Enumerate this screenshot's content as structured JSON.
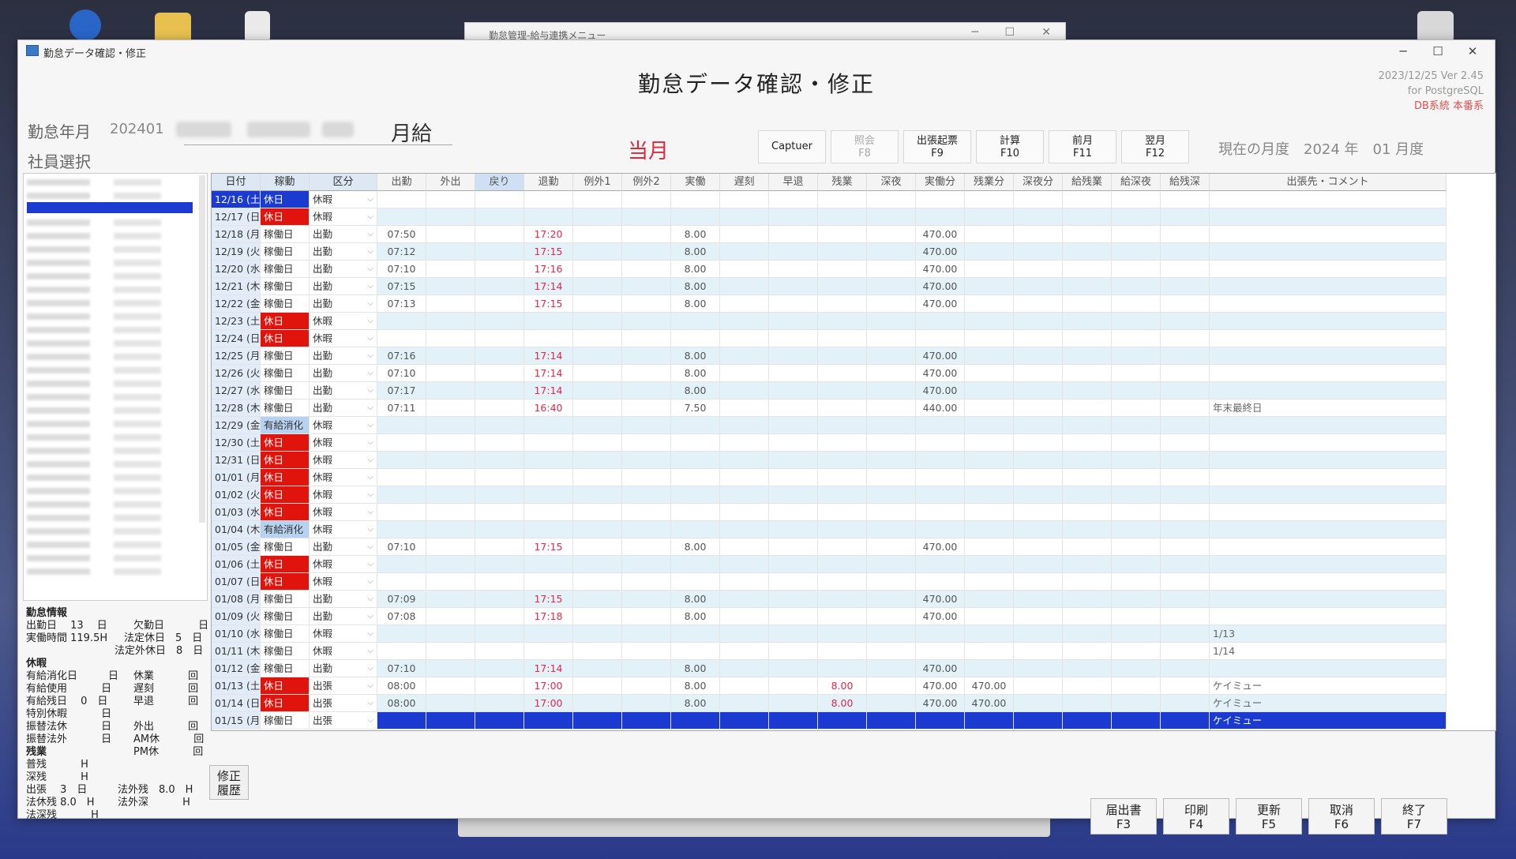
{
  "background_window": {
    "title": "勤怠管理-給与連携メニュー"
  },
  "window": {
    "title": "勤怠データ確認・修正"
  },
  "header": {
    "title": "勤怠データ確認・修正",
    "version": [
      "2023/12/25 Ver 2.45",
      "for PostgreSQL",
      "DB系統 本番系"
    ]
  },
  "filters": {
    "ym_label": "勤怠年月",
    "ym_value": "202401",
    "pay_type": "月給",
    "employee_label": "社員選択",
    "current_month_badge": "当月",
    "current_period": "現在の月度　2024 年　01 月度"
  },
  "toolbar": [
    {
      "label": "Captuer",
      "key": "",
      "disabled": false
    },
    {
      "label": "照会",
      "key": "F8",
      "disabled": true
    },
    {
      "label": "出張起票",
      "key": "F9",
      "disabled": false
    },
    {
      "label": "計算",
      "key": "F10",
      "disabled": false
    },
    {
      "label": "前月",
      "key": "F11",
      "disabled": false
    },
    {
      "label": "翌月",
      "key": "F12",
      "disabled": false
    }
  ],
  "columns": [
    "日付",
    "稼動",
    "区分",
    "出勤",
    "外出",
    "戻り",
    "退勤",
    "例外1",
    "例外2",
    "実働",
    "遅刻",
    "早退",
    "残業",
    "深夜",
    "実働分",
    "残業分",
    "深夜分",
    "給残業",
    "給深夜",
    "給残深",
    "出張先・コメント"
  ],
  "rows": [
    {
      "date": "12/16 (土)",
      "kado": "休日",
      "kubun": "休暇",
      "in": "",
      "out": "",
      "work": "",
      "zan": "",
      "wmin": "",
      "zmin": "",
      "comment": "",
      "type": "sel"
    },
    {
      "date": "12/17 (日)",
      "kado": "休日",
      "kubun": "休暇",
      "in": "",
      "out": "",
      "work": "",
      "zan": "",
      "wmin": "",
      "zmin": "",
      "comment": "",
      "type": "holiday"
    },
    {
      "date": "12/18 (月)",
      "kado": "稼働日",
      "kubun": "出勤",
      "in": "07:50",
      "out": "17:20",
      "work": "8.00",
      "zan": "",
      "wmin": "470.00",
      "zmin": "",
      "comment": "",
      "type": ""
    },
    {
      "date": "12/19 (火)",
      "kado": "稼働日",
      "kubun": "出勤",
      "in": "07:12",
      "out": "17:15",
      "work": "8.00",
      "zan": "",
      "wmin": "470.00",
      "zmin": "",
      "comment": "",
      "type": ""
    },
    {
      "date": "12/20 (水)",
      "kado": "稼働日",
      "kubun": "出勤",
      "in": "07:10",
      "out": "17:16",
      "work": "8.00",
      "zan": "",
      "wmin": "470.00",
      "zmin": "",
      "comment": "",
      "type": ""
    },
    {
      "date": "12/21 (木)",
      "kado": "稼働日",
      "kubun": "出勤",
      "in": "07:15",
      "out": "17:14",
      "work": "8.00",
      "zan": "",
      "wmin": "470.00",
      "zmin": "",
      "comment": "",
      "type": ""
    },
    {
      "date": "12/22 (金)",
      "kado": "稼働日",
      "kubun": "出勤",
      "in": "07:13",
      "out": "17:15",
      "work": "8.00",
      "zan": "",
      "wmin": "470.00",
      "zmin": "",
      "comment": "",
      "type": ""
    },
    {
      "date": "12/23 (土)",
      "kado": "休日",
      "kubun": "休暇",
      "in": "",
      "out": "",
      "work": "",
      "zan": "",
      "wmin": "",
      "zmin": "",
      "comment": "",
      "type": "holiday"
    },
    {
      "date": "12/24 (日)",
      "kado": "休日",
      "kubun": "休暇",
      "in": "",
      "out": "",
      "work": "",
      "zan": "",
      "wmin": "",
      "zmin": "",
      "comment": "",
      "type": "holiday"
    },
    {
      "date": "12/25 (月)",
      "kado": "稼働日",
      "kubun": "出勤",
      "in": "07:16",
      "out": "17:14",
      "work": "8.00",
      "zan": "",
      "wmin": "470.00",
      "zmin": "",
      "comment": "",
      "type": ""
    },
    {
      "date": "12/26 (火)",
      "kado": "稼働日",
      "kubun": "出勤",
      "in": "07:10",
      "out": "17:14",
      "work": "8.00",
      "zan": "",
      "wmin": "470.00",
      "zmin": "",
      "comment": "",
      "type": ""
    },
    {
      "date": "12/27 (水)",
      "kado": "稼働日",
      "kubun": "出勤",
      "in": "07:17",
      "out": "17:14",
      "work": "8.00",
      "zan": "",
      "wmin": "470.00",
      "zmin": "",
      "comment": "",
      "type": ""
    },
    {
      "date": "12/28 (木)",
      "kado": "稼働日",
      "kubun": "出勤",
      "in": "07:11",
      "out": "16:40",
      "work": "7.50",
      "zan": "",
      "wmin": "440.00",
      "zmin": "",
      "comment": "年末最終日",
      "type": ""
    },
    {
      "date": "12/29 (金)",
      "kado": "有給消化",
      "kubun": "休暇",
      "in": "",
      "out": "",
      "work": "",
      "zan": "",
      "wmin": "",
      "zmin": "",
      "comment": "",
      "type": "paid"
    },
    {
      "date": "12/30 (土)",
      "kado": "休日",
      "kubun": "休暇",
      "in": "",
      "out": "",
      "work": "",
      "zan": "",
      "wmin": "",
      "zmin": "",
      "comment": "",
      "type": "holiday"
    },
    {
      "date": "12/31 (日)",
      "kado": "休日",
      "kubun": "休暇",
      "in": "",
      "out": "",
      "work": "",
      "zan": "",
      "wmin": "",
      "zmin": "",
      "comment": "",
      "type": "holiday"
    },
    {
      "date": "01/01 (月)",
      "kado": "休日",
      "kubun": "休暇",
      "in": "",
      "out": "",
      "work": "",
      "zan": "",
      "wmin": "",
      "zmin": "",
      "comment": "",
      "type": "holiday"
    },
    {
      "date": "01/02 (火)",
      "kado": "休日",
      "kubun": "休暇",
      "in": "",
      "out": "",
      "work": "",
      "zan": "",
      "wmin": "",
      "zmin": "",
      "comment": "",
      "type": "holiday"
    },
    {
      "date": "01/03 (水)",
      "kado": "休日",
      "kubun": "休暇",
      "in": "",
      "out": "",
      "work": "",
      "zan": "",
      "wmin": "",
      "zmin": "",
      "comment": "",
      "type": "holiday"
    },
    {
      "date": "01/04 (木)",
      "kado": "有給消化",
      "kubun": "休暇",
      "in": "",
      "out": "",
      "work": "",
      "zan": "",
      "wmin": "",
      "zmin": "",
      "comment": "",
      "type": "paid"
    },
    {
      "date": "01/05 (金)",
      "kado": "稼働日",
      "kubun": "出勤",
      "in": "07:10",
      "out": "17:15",
      "work": "8.00",
      "zan": "",
      "wmin": "470.00",
      "zmin": "",
      "comment": "",
      "type": ""
    },
    {
      "date": "01/06 (土)",
      "kado": "休日",
      "kubun": "休暇",
      "in": "",
      "out": "",
      "work": "",
      "zan": "",
      "wmin": "",
      "zmin": "",
      "comment": "",
      "type": "holiday"
    },
    {
      "date": "01/07 (日)",
      "kado": "休日",
      "kubun": "休暇",
      "in": "",
      "out": "",
      "work": "",
      "zan": "",
      "wmin": "",
      "zmin": "",
      "comment": "",
      "type": "holiday"
    },
    {
      "date": "01/08 (月)",
      "kado": "稼働日",
      "kubun": "出勤",
      "in": "07:09",
      "out": "17:15",
      "work": "8.00",
      "zan": "",
      "wmin": "470.00",
      "zmin": "",
      "comment": "",
      "type": ""
    },
    {
      "date": "01/09 (火)",
      "kado": "稼働日",
      "kubun": "出勤",
      "in": "07:08",
      "out": "17:18",
      "work": "8.00",
      "zan": "",
      "wmin": "470.00",
      "zmin": "",
      "comment": "",
      "type": ""
    },
    {
      "date": "01/10 (水)",
      "kado": "稼働日",
      "kubun": "休暇",
      "in": "",
      "out": "",
      "work": "",
      "zan": "",
      "wmin": "",
      "zmin": "",
      "comment": "1/13",
      "type": ""
    },
    {
      "date": "01/11 (木)",
      "kado": "稼働日",
      "kubun": "休暇",
      "in": "",
      "out": "",
      "work": "",
      "zan": "",
      "wmin": "",
      "zmin": "",
      "comment": "1/14",
      "type": ""
    },
    {
      "date": "01/12 (金)",
      "kado": "稼働日",
      "kubun": "出勤",
      "in": "07:10",
      "out": "17:14",
      "work": "8.00",
      "zan": "",
      "wmin": "470.00",
      "zmin": "",
      "comment": "",
      "type": ""
    },
    {
      "date": "01/13 (土)",
      "kado": "休日",
      "kubun": "出張",
      "in": "08:00",
      "out": "17:00",
      "work": "8.00",
      "zan": "8.00",
      "wmin": "470.00",
      "zmin": "470.00",
      "comment": "ケイミュー",
      "type": "holiday"
    },
    {
      "date": "01/14 (日)",
      "kado": "休日",
      "kubun": "出張",
      "in": "08:00",
      "out": "17:00",
      "work": "8.00",
      "zan": "8.00",
      "wmin": "470.00",
      "zmin": "470.00",
      "comment": "ケイミュー",
      "type": "holiday"
    },
    {
      "date": "01/15 (月)",
      "kado": "稼働日",
      "kubun": "出張",
      "in": "",
      "out": "",
      "work": "",
      "zan": "",
      "wmin": "",
      "zmin": "",
      "comment": "ケイミュー",
      "type": "bluerow"
    }
  ],
  "info": {
    "section_attendance": "勤怠情報",
    "work_days": "出勤日　 13　 日",
    "absent_days": "欠勤日　　　 日",
    "work_hours": "実働時間 119.5H",
    "legal_holiday": "法定休日　5　日",
    "nonlegal_holiday": "法定外休日　8　日",
    "section_leave": "休暇",
    "paid_used_day": "有給消化日　　　日",
    "kyugyo": "休業　　　 回",
    "paid_use": "有給使用　　　 日",
    "late": "遅刻　　　 回",
    "paid_remain": "有給残日　 0　日",
    "early": "早退　　　 回",
    "special_leave": "特別休暇　　　 日",
    "out": "外出　　　 回",
    "sub_legal": "振替法休　　　 日",
    "am_off": "AM休　　　 回",
    "sub_nonlegal": "振替法外　　　 日",
    "pm_off": "PM休　　　 回",
    "section_overtime": "残業",
    "normal_ot": "普残　　　 H",
    "night_ot": "深残　　　 H",
    "trip": "出張　 3　日",
    "nonlegal_ot": "法外残　8.0　H",
    "legal_rest_ot": "法休残 8.0　H",
    "nonlegal_late": "法外深　　　 H",
    "legal_deep": "法深残　　　 H",
    "history_button": "修正\n履歴"
  },
  "footer_buttons": [
    {
      "label": "届出書",
      "key": "F3"
    },
    {
      "label": "印刷",
      "key": "F4"
    },
    {
      "label": "更新",
      "key": "F5"
    },
    {
      "label": "取消",
      "key": "F6"
    },
    {
      "label": "終了",
      "key": "F7"
    }
  ]
}
